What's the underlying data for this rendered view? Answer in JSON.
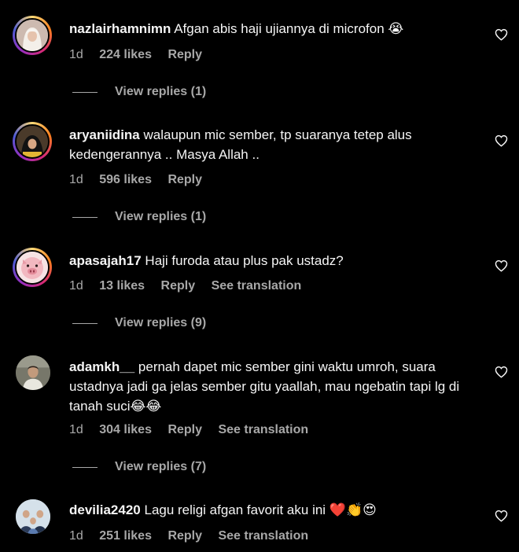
{
  "comments": [
    {
      "username": "nazlairhamnimn",
      "text": "Afgan abis haji ujiannya di microfon 😭",
      "date": "1d",
      "likes": "224 likes",
      "reply": "Reply",
      "translation": "",
      "view_replies": "View replies (1)",
      "avatar_icon": "person-hijab-photo"
    },
    {
      "username": "aryaniidina",
      "text": "walaupun mic sember, tp suaranya tetep alus kedengerannya .. Masya Allah ..",
      "date": "1d",
      "likes": "596 likes",
      "reply": "Reply",
      "translation": "",
      "view_replies": "View replies (1)",
      "avatar_icon": "person-hijab-photo"
    },
    {
      "username": "apasajah17",
      "text": "Haji furoda atau plus pak ustadz?",
      "date": "1d",
      "likes": "13 likes",
      "reply": "Reply",
      "translation": "See translation",
      "view_replies": "View replies (9)",
      "avatar_icon": "pig-face"
    },
    {
      "username": "adamkh__",
      "text": "pernah dapet mic sember gini waktu umroh, suara ustadnya jadi ga jelas sember gitu yaallah, mau ngebatin tapi lg di tanah suci😂😂",
      "date": "1d",
      "likes": "304 likes",
      "reply": "Reply",
      "translation": "See translation",
      "view_replies": "View replies (7)",
      "avatar_icon": "person-photo"
    },
    {
      "username": "devilia2420",
      "text": "Lagu religi afgan favorit aku ini ❤️👏😍",
      "date": "1d",
      "likes": "251 likes",
      "reply": "Reply",
      "translation": "See translation",
      "view_replies": "",
      "avatar_icon": "group-photo"
    }
  ],
  "icons": {
    "like": "heart-outline-icon"
  },
  "colors": {
    "background": "#000000",
    "text": "#f5f5f5",
    "secondary": "#a8a8a8"
  }
}
